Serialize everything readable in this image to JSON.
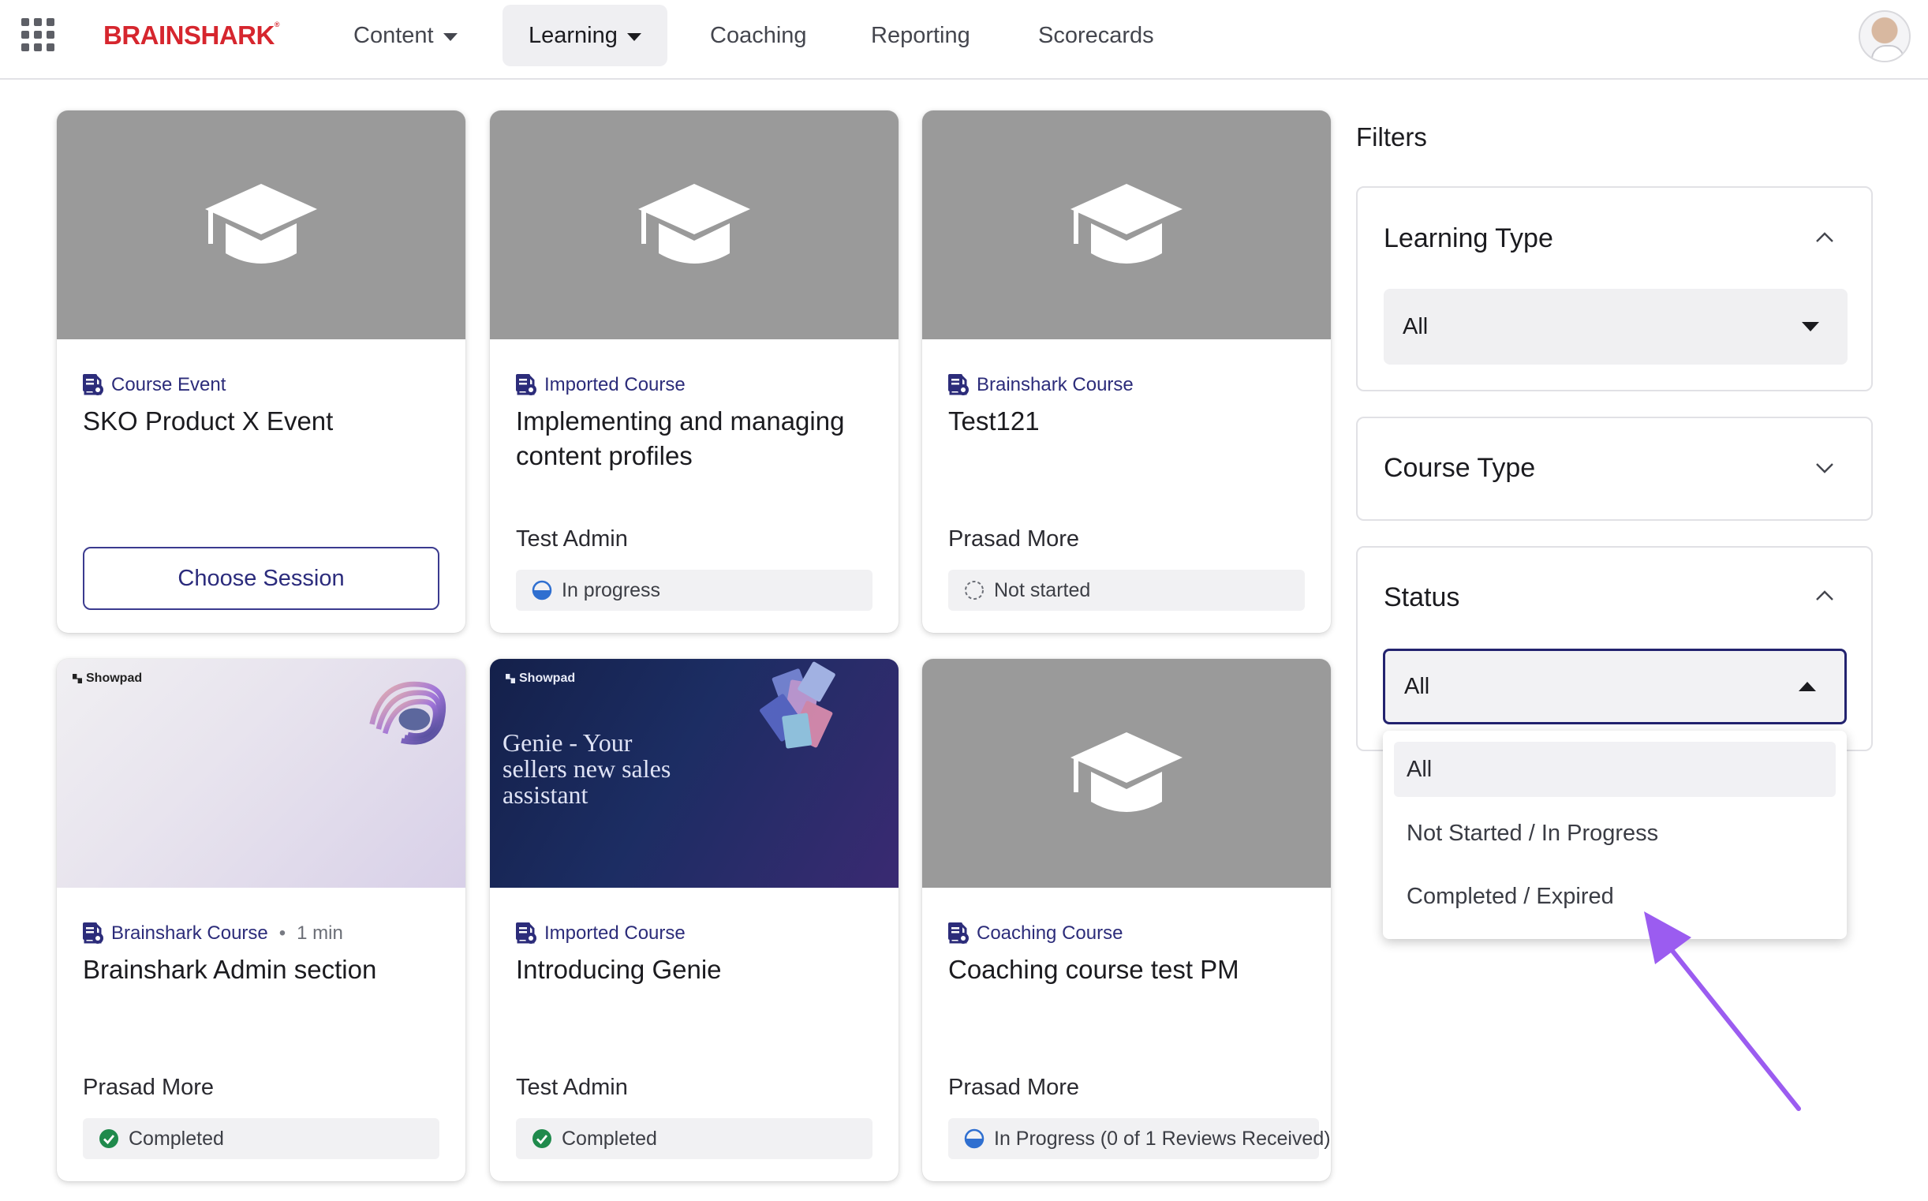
{
  "brand": {
    "name": "BRAINSHARK",
    "mark": "®"
  },
  "nav": {
    "items": [
      {
        "label": "Content",
        "has_dropdown": true,
        "active": false
      },
      {
        "label": "Learning",
        "has_dropdown": true,
        "active": true
      },
      {
        "label": "Coaching",
        "has_dropdown": false,
        "active": false
      },
      {
        "label": "Reporting",
        "has_dropdown": false,
        "active": false
      },
      {
        "label": "Scorecards",
        "has_dropdown": false,
        "active": false
      }
    ]
  },
  "cards": [
    {
      "type": "Course Event",
      "title": "SKO Product X Event",
      "action": "Choose Session",
      "thumbnail": "graduation-cap-icon"
    },
    {
      "type": "Imported Course",
      "title": "Implementing and managing content profiles",
      "author": "Test Admin",
      "status": "In progress",
      "status_icon": "half-circle-icon",
      "thumbnail": "graduation-cap-icon"
    },
    {
      "type": "Brainshark Course",
      "title": "Test121",
      "author": "Prasad More",
      "status": "Not started",
      "status_icon": "dashed-circle-icon",
      "thumbnail": "graduation-cap-icon"
    },
    {
      "type": "Brainshark Course",
      "duration": "1 min",
      "separator": "•",
      "title": "Brainshark Admin section",
      "author": "Prasad More",
      "status": "Completed",
      "status_icon": "check-circle-icon",
      "thumbnail": "showpad-abstract-image",
      "thumb_tag": "Showpad"
    },
    {
      "type": "Imported Course",
      "title": "Introducing Genie",
      "author": "Test Admin",
      "status": "Completed",
      "status_icon": "check-circle-icon",
      "thumbnail": "showpad-genie-image",
      "thumb_tag": "Showpad",
      "thumb_text": "Genie - Your sellers new sales assistant"
    },
    {
      "type": "Coaching Course",
      "title": "Coaching course test PM",
      "author": "Prasad More",
      "status": "In Progress (0 of 1 Reviews Received)",
      "status_icon": "half-circle-icon",
      "thumbnail": "graduation-cap-icon"
    }
  ],
  "filters": {
    "title": "Filters",
    "learning_type": {
      "label": "Learning Type",
      "value": "All",
      "expanded": true
    },
    "course_type": {
      "label": "Course Type",
      "expanded": false
    },
    "status": {
      "label": "Status",
      "value": "All",
      "expanded": true,
      "options": [
        "All",
        "Not Started / In Progress",
        "Completed / Expired"
      ],
      "selected_option": "All"
    }
  },
  "colors": {
    "brand_red": "#d6262e",
    "accent_navy": "#2c2c7a",
    "completed_green": "#1f8a4c",
    "progress_blue": "#2f6fd0",
    "annotation_purple": "#9b5cf0"
  }
}
